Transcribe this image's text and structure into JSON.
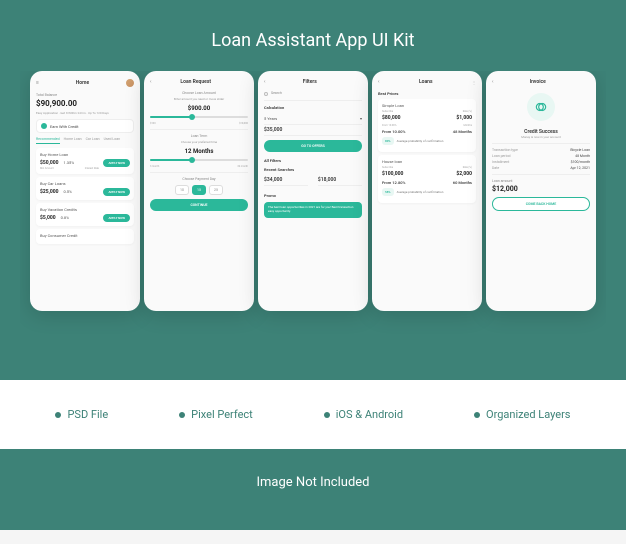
{
  "hero_title": "Loan Assistant App UI Kit",
  "features": [
    "PSD File",
    "Pixel Perfect",
    "iOS & Android",
    "Organized Layers"
  ],
  "footer_text": "Image Not Included",
  "screens": {
    "home": {
      "title": "Home",
      "balance_label": "Total Balance",
      "balance": "$90,900.00",
      "tagline": "Easy Application · Get It Within 24 hrs · Up To 120 Days",
      "earn_label": "Earn With Credit",
      "tabs": [
        "Recommended",
        "Home Loan",
        "Car Loan",
        "Used Loan"
      ],
      "loans": [
        {
          "name": "Buy Home Loan",
          "amount": "$50,000",
          "rate": "1.35%",
          "min_label": "Min Amount",
          "rate_label": "Interest Rate"
        },
        {
          "name": "Buy Car Loans",
          "amount": "$25,000",
          "rate": "0.5%",
          "min_label": "Min Amount",
          "rate_label": "Interest Rate"
        },
        {
          "name": "Buy Vacation Credits",
          "amount": "$5,000",
          "rate": "0.8%",
          "min_label": "Min Amount",
          "rate_label": "Interest Rate"
        },
        {
          "name": "Buy Consumer Credit",
          "amount": "",
          "rate": "",
          "min_label": "",
          "rate_label": ""
        }
      ],
      "apply_label": "APPLY NOW"
    },
    "request": {
      "title": "Loan Request",
      "amount_label": "Choose Loan Amount",
      "amount_sub": "Enter amount you need or move slider",
      "amount": "$900.00",
      "slider_min": "$100",
      "slider_max": "$10,000",
      "term_label": "Loan Term",
      "term_sub": "Choose your preferred time",
      "term": "12 Months",
      "term_min": "3 month",
      "term_max": "36 month",
      "payday_label": "Choose Payment Day",
      "days": [
        "10",
        "15",
        "25"
      ],
      "active_day": "15",
      "continue_label": "CONTINUE"
    },
    "filters": {
      "title": "Filters",
      "search_placeholder": "Search",
      "calc_label": "Calculation",
      "term_value": "5 Years",
      "amount_value": "$35,000",
      "offers_btn": "GO TO OFFERS",
      "all_filters": "All Filters",
      "recent_label": "Recent Searches",
      "recent": [
        "$34,000",
        "$18,000"
      ],
      "promo_label": "Promo",
      "promo_text": "The best loan opportunities in 2021 are for you! Best transaction easy opportunity."
    },
    "loans": {
      "title": "Loans",
      "best_label": "Best Prices",
      "simple": {
        "name": "Simple Loan",
        "sub_label": "Subscribe",
        "rate_label": "Rate (%)",
        "amount": "$80,000",
        "rate": "$1,000",
        "from_label": "From 10.00%",
        "months_label": "Months",
        "months": "48 Months",
        "prob_pct": "80%",
        "prob_text": "Average probability of confirmation"
      },
      "house": {
        "name": "House loan",
        "sub_label": "Subscribe",
        "rate_label": "Rate (%)",
        "amount": "$100,000",
        "rate": "$2,000",
        "from_label": "From 12.80%",
        "months_label": "Months",
        "months": "60 Months",
        "prob_pct": "58%",
        "prob_text": "Average probability of confirmation"
      }
    },
    "invoice": {
      "title": "Invoice",
      "success_title": "Credit Success",
      "success_sub": "Money is now in your account",
      "rows": [
        {
          "label": "Transaction type",
          "value": "Bicycle Loan"
        },
        {
          "label": "Loan period",
          "value": "48 Month"
        },
        {
          "label": "Installment",
          "value": "$100/month"
        },
        {
          "label": "Date",
          "value": "Apr 12, 2021"
        }
      ],
      "amount_label": "Loan amount",
      "amount": "$12,000",
      "back_btn": "COME BACK HOME"
    }
  },
  "colors": {
    "brand": "#3d8277",
    "accent": "#2bb89a"
  }
}
